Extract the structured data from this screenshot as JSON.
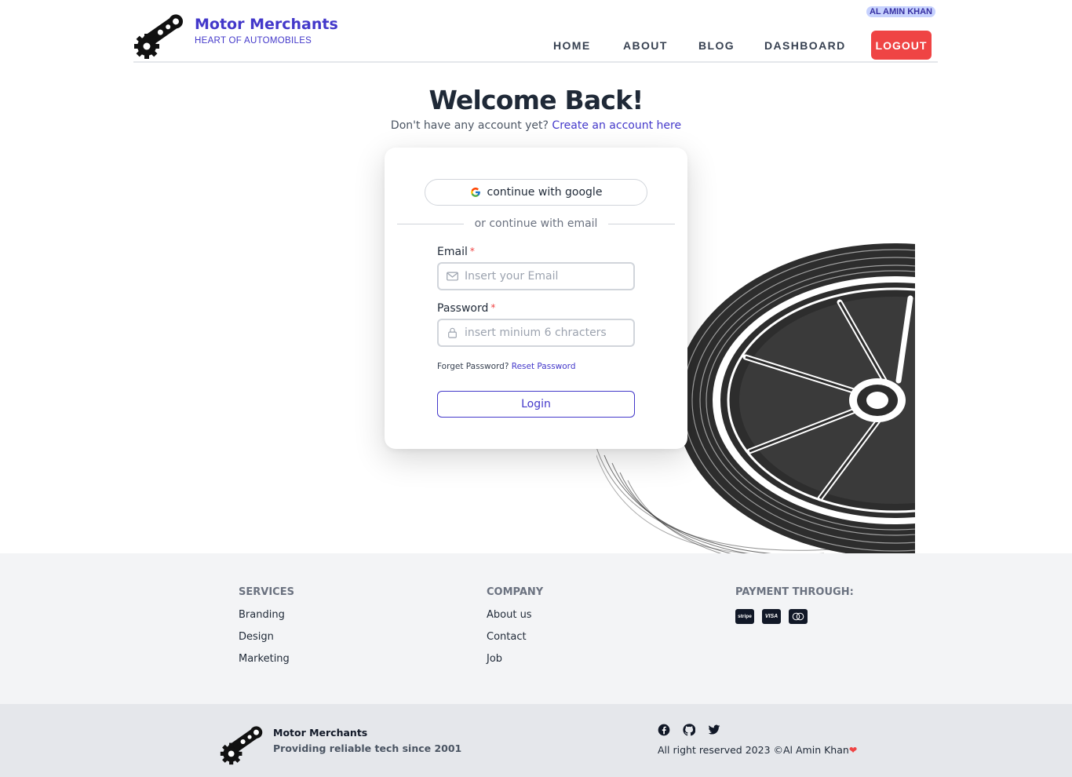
{
  "header": {
    "brand_name": "Motor Merchants",
    "brand_tagline": "HEART OF AUTOMOBILES",
    "user_name": "AL AMIN KHAN",
    "nav": {
      "home": "HOME",
      "about": "ABOUT",
      "blog": "BLOG",
      "dashboard": "DASHBOARD"
    },
    "logout_label": "LOGOUT"
  },
  "hero": {
    "title": "Welcome Back!",
    "prompt": "Don't have any account yet?",
    "create_link": "Create an account here"
  },
  "login_card": {
    "google_label": "continue with google",
    "divider_text": "or continue with email",
    "email_label": "Email",
    "email_placeholder": "Insert your Email",
    "password_label": "Password",
    "password_placeholder": "insert minium 6 chracters",
    "required_mark": "*",
    "forgot_text": "Forget Password?",
    "reset_link": "Reset Password",
    "login_label": "Login"
  },
  "footer": {
    "services": {
      "heading": "SERVICES",
      "links": [
        "Branding",
        "Design",
        "Marketing"
      ]
    },
    "company": {
      "heading": "COMPANY",
      "links": [
        "About us",
        "Contact",
        "Job"
      ]
    },
    "payment": {
      "heading": "PAYMENT THROUGH:",
      "methods": [
        "stripe",
        "VISA",
        "mastercard"
      ]
    },
    "bottom": {
      "brand_name": "Motor Merchants",
      "tagline": "Providing reliable tech since 2001",
      "copyright": "All right reserved 2023 ©Al Amin Khan",
      "socials": [
        "facebook-icon",
        "github-icon",
        "twitter-icon"
      ]
    }
  },
  "colors": {
    "primary": "#4338ca",
    "danger": "#ef4444",
    "badge_bg": "#c7d2fe",
    "footer_light": "#f3f4f6",
    "footer_dark": "#e5e7eb"
  }
}
